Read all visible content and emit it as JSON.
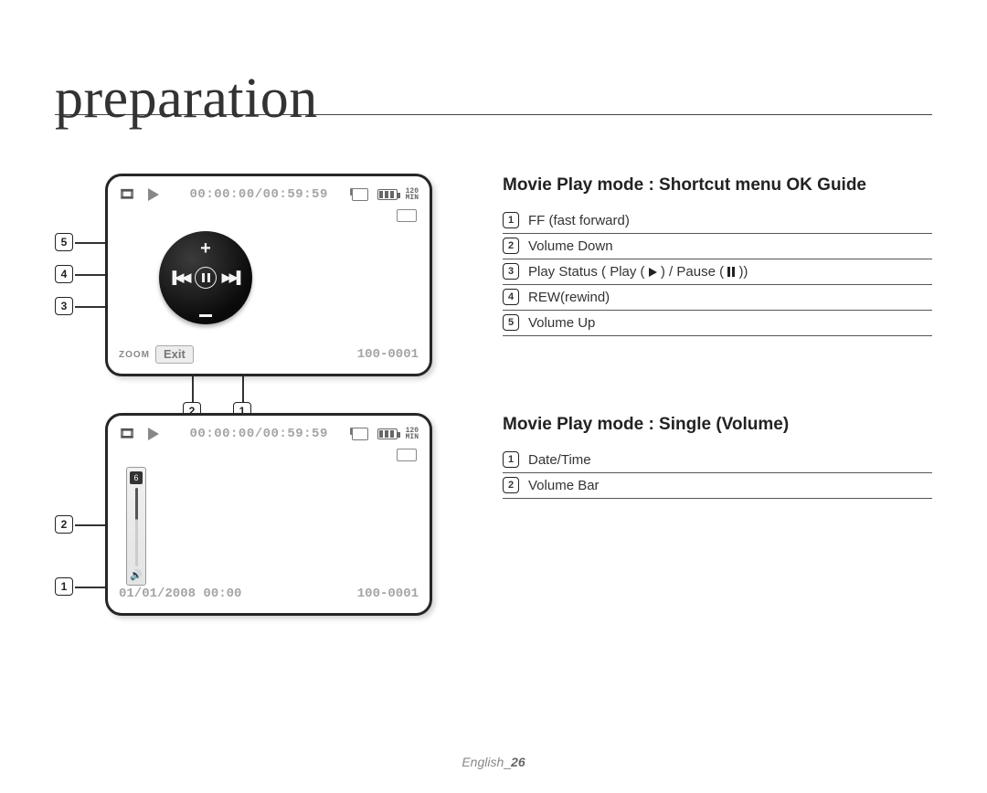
{
  "header": {
    "title": "preparation"
  },
  "screen1": {
    "time": "00:00:00/00:59:59",
    "min_label_top": "120",
    "min_label_bot": "MIN",
    "zoom": "ZOOM",
    "exit": "Exit",
    "fileno": "100-0001"
  },
  "section1": {
    "title": "Movie Play mode : Shortcut menu OK Guide",
    "items": {
      "1": "FF (fast forward)",
      "2": "Volume Down",
      "3": "Play Status ( Play ( ▶ ) / Pause ( ❚❚ ))",
      "3_prefix": "Play Status ( Play (",
      "3_mid": ") / Pause (",
      "3_suffix": "))",
      "4": "REW(rewind)",
      "5": "Volume Up"
    }
  },
  "screen2": {
    "time": "00:00:00/00:59:59",
    "datetime": "01/01/2008 00:00",
    "fileno": "100-0001",
    "vol_level": "6",
    "min_label_top": "120",
    "min_label_bot": "MIN"
  },
  "section2": {
    "title": "Movie Play mode : Single (Volume)",
    "items": {
      "1": "Date/Time",
      "2": "Volume Bar"
    }
  },
  "footer": {
    "lang": "English",
    "sep": "_",
    "page": "26"
  }
}
